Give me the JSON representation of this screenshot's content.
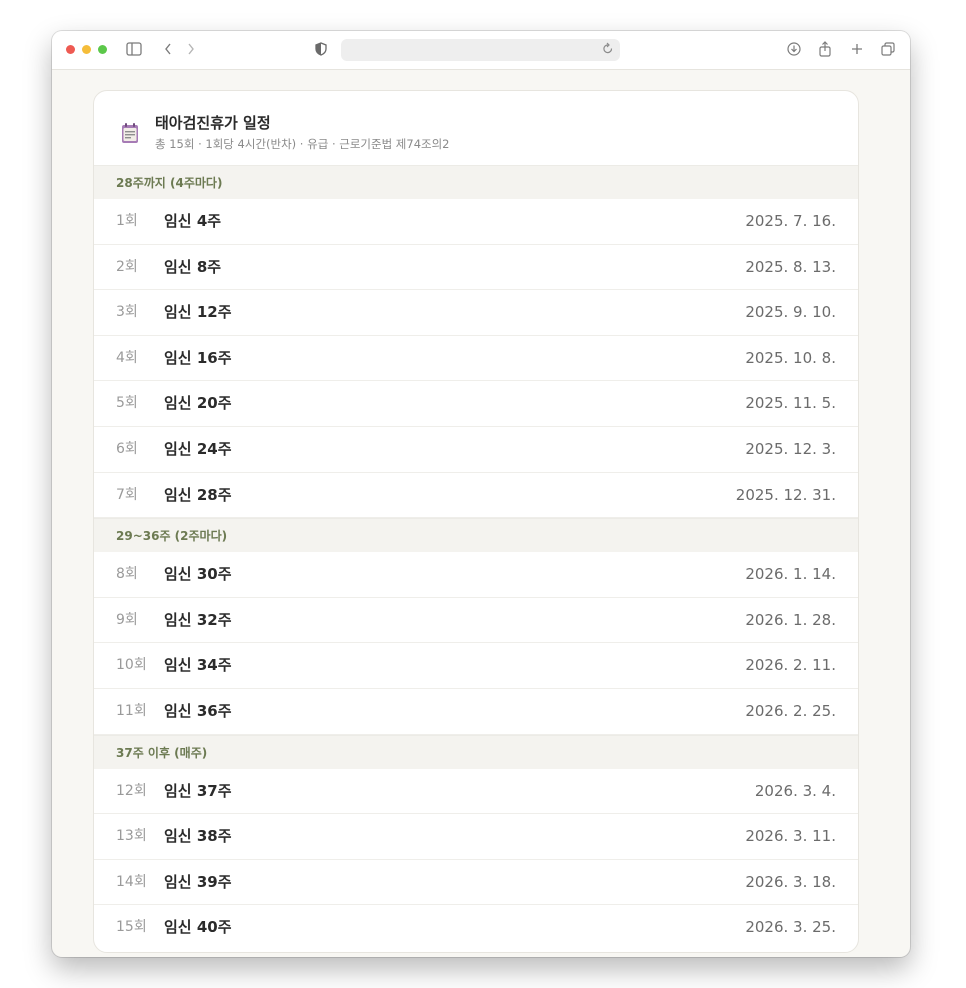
{
  "browser": {
    "icons": [
      "sidebar-icon",
      "back-icon",
      "forward-icon",
      "shield-icon",
      "reload-icon",
      "download-icon",
      "share-icon",
      "new-tab-icon",
      "tabs-overview-icon"
    ]
  },
  "schedule": {
    "title": "태아검진휴가 일정",
    "subtitle": "총 15회 · 1회당 4시간(반차) · 유급 · 근로기준법 제74조의2",
    "accent_color": "#6c7a52",
    "sections": [
      {
        "label": "28주까지 (4주마다)",
        "rows": [
          {
            "num": "1회",
            "week": "임신 4주",
            "date": "2025. 7. 16."
          },
          {
            "num": "2회",
            "week": "임신 8주",
            "date": "2025. 8. 13."
          },
          {
            "num": "3회",
            "week": "임신 12주",
            "date": "2025. 9. 10."
          },
          {
            "num": "4회",
            "week": "임신 16주",
            "date": "2025. 10. 8."
          },
          {
            "num": "5회",
            "week": "임신 20주",
            "date": "2025. 11. 5."
          },
          {
            "num": "6회",
            "week": "임신 24주",
            "date": "2025. 12. 3."
          },
          {
            "num": "7회",
            "week": "임신 28주",
            "date": "2025. 12. 31."
          }
        ]
      },
      {
        "label": "29~36주 (2주마다)",
        "rows": [
          {
            "num": "8회",
            "week": "임신 30주",
            "date": "2026. 1. 14."
          },
          {
            "num": "9회",
            "week": "임신 32주",
            "date": "2026. 1. 28."
          },
          {
            "num": "10회",
            "week": "임신 34주",
            "date": "2026. 2. 11."
          },
          {
            "num": "11회",
            "week": "임신 36주",
            "date": "2026. 2. 25."
          }
        ]
      },
      {
        "label": "37주 이후 (매주)",
        "rows": [
          {
            "num": "12회",
            "week": "임신 37주",
            "date": "2026. 3. 4."
          },
          {
            "num": "13회",
            "week": "임신 38주",
            "date": "2026. 3. 11."
          },
          {
            "num": "14회",
            "week": "임신 39주",
            "date": "2026. 3. 18."
          },
          {
            "num": "15회",
            "week": "임신 40주",
            "date": "2026. 3. 25."
          }
        ]
      }
    ]
  }
}
